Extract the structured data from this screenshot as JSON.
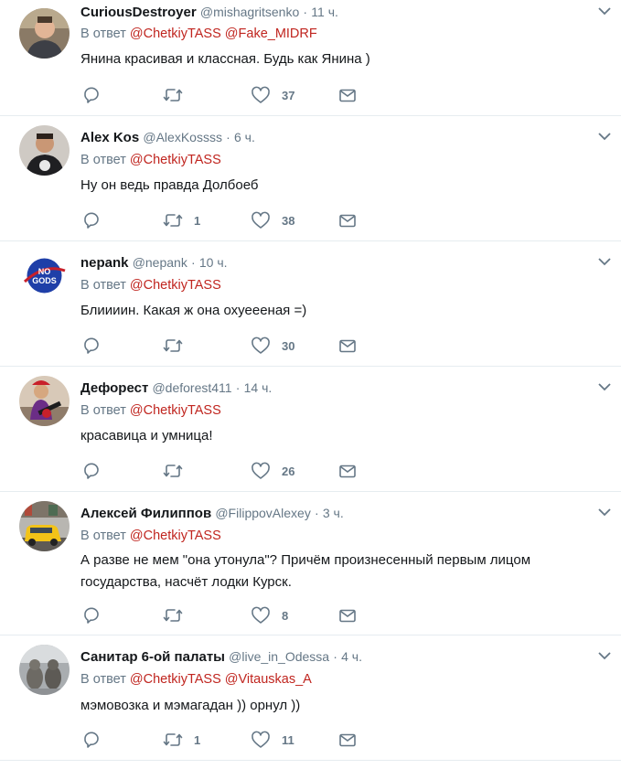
{
  "labels": {
    "reply_prefix": "В ответ",
    "separator": "·"
  },
  "colors": {
    "mention": "#c0251f",
    "secondary": "#657786",
    "divider": "#e6ecf0"
  },
  "tweets": [
    {
      "name": "CuriousDestroyer",
      "handle": "@mishagritsenko",
      "time": "11 ч.",
      "mentions": [
        "@ChetkiyTASS",
        "@Fake_MIDRF"
      ],
      "text": "Янина красивая и классная. Будь как Янина )",
      "retweets": "",
      "likes": "37",
      "avatar": "man-photo-avatar"
    },
    {
      "name": "Alex Kos",
      "handle": "@AlexKossss",
      "time": "6 ч.",
      "mentions": [
        "@ChetkiyTASS"
      ],
      "text": "Ну он ведь правда Долбоеб",
      "retweets": "1",
      "likes": "38",
      "avatar": "man-tshirt-avatar"
    },
    {
      "name": "nepank",
      "handle": "@nepank",
      "time": "10 ч.",
      "mentions": [
        "@ChetkiyTASS"
      ],
      "text": "Блиииин. Какая ж она охуеееная =)",
      "retweets": "",
      "likes": "30",
      "avatar": "no-gods-logo-avatar"
    },
    {
      "name": "Дефорест",
      "handle": "@deforest411",
      "time": "14 ч.",
      "mentions": [
        "@ChetkiyTASS"
      ],
      "text": "красавица и умница!",
      "retweets": "",
      "likes": "26",
      "avatar": "guitarist-avatar"
    },
    {
      "name": "Алексей Филиппов",
      "handle": "@FilippovAlexey",
      "time": "3 ч.",
      "mentions": [
        "@ChetkiyTASS"
      ],
      "text": "А разве не мем \"она утонула\"? Причём произнесенный первым лицом государства, насчёт лодки Курск.",
      "retweets": "",
      "likes": "8",
      "avatar": "yellow-car-street-avatar"
    },
    {
      "name": "Санитар 6-ой палаты",
      "handle": "@live_in_Odessa",
      "time": "4 ч.",
      "mentions": [
        "@ChetkiyTASS",
        "@Vitauskas_A"
      ],
      "text": "мэмовозка и мэмагадан )) орнул ))",
      "retweets": "1",
      "likes": "11",
      "avatar": "two-cats-avatar"
    }
  ]
}
